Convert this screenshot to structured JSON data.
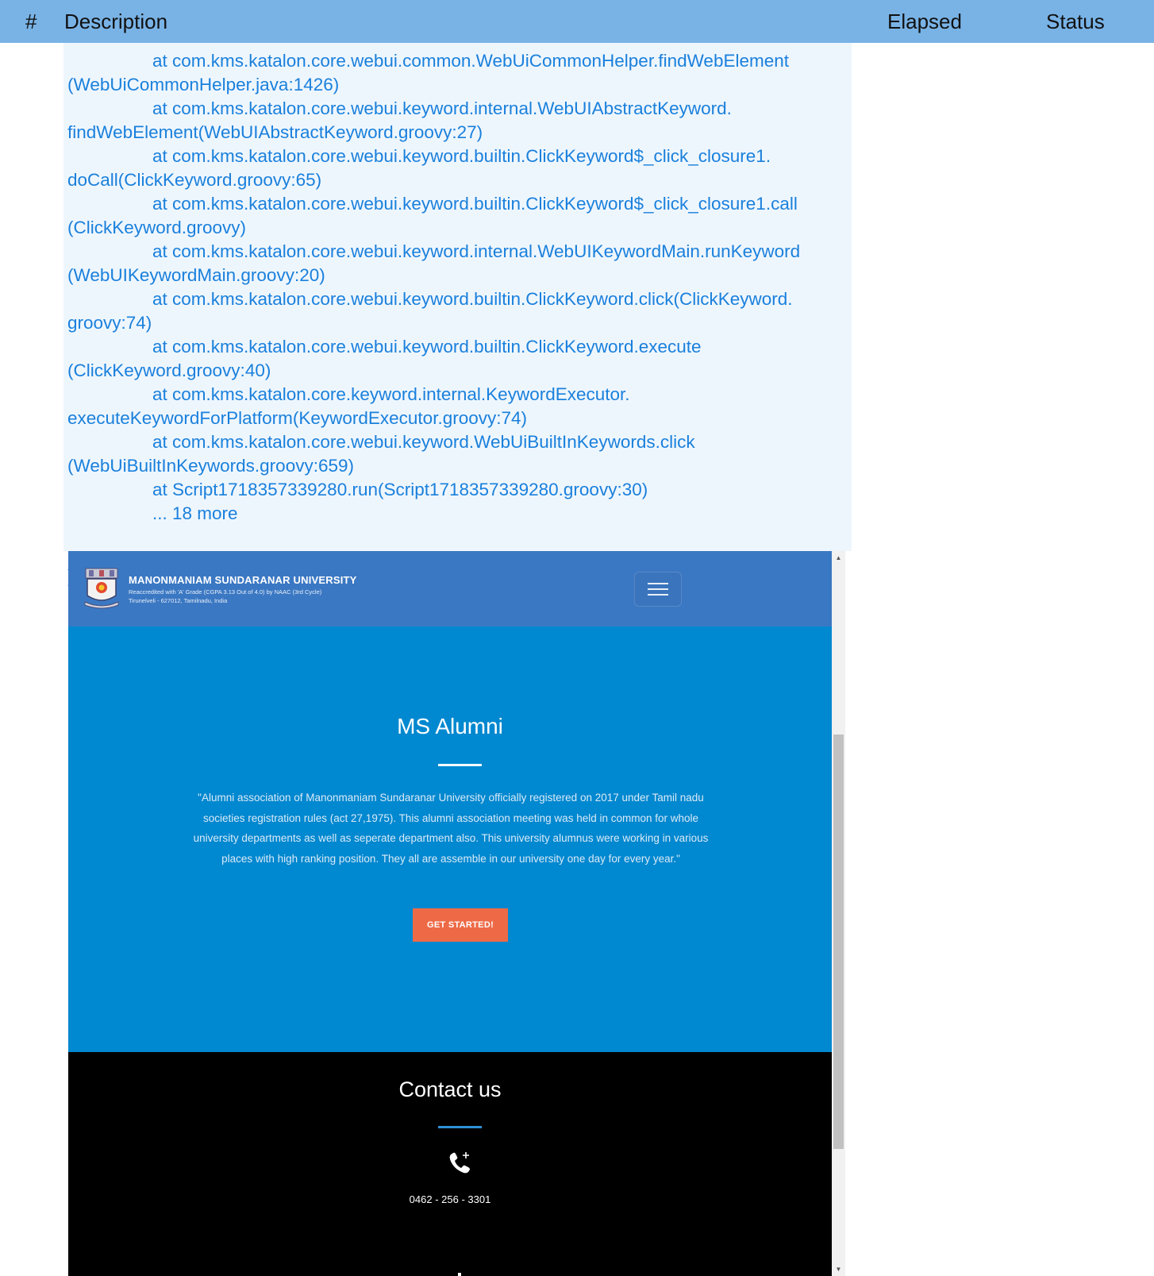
{
  "report_header": {
    "hash": "#",
    "description": "Description",
    "elapsed": "Elapsed",
    "status": "Status"
  },
  "log": {
    "lines": [
      {
        "indent": true,
        "text": "at com.kms.katalon.core.webui.common.WebUiCommonHelper.findWebElement"
      },
      {
        "indent": false,
        "text": "(WebUiCommonHelper.java:1426)"
      },
      {
        "indent": true,
        "text": "at com.kms.katalon.core.webui.keyword.internal.WebUIAbstractKeyword."
      },
      {
        "indent": false,
        "text": "findWebElement(WebUIAbstractKeyword.groovy:27)"
      },
      {
        "indent": true,
        "text": "at com.kms.katalon.core.webui.keyword.builtin.ClickKeyword$_click_closure1."
      },
      {
        "indent": false,
        "text": "doCall(ClickKeyword.groovy:65)"
      },
      {
        "indent": true,
        "text": "at com.kms.katalon.core.webui.keyword.builtin.ClickKeyword$_click_closure1.call"
      },
      {
        "indent": false,
        "text": "(ClickKeyword.groovy)"
      },
      {
        "indent": true,
        "text": "at com.kms.katalon.core.webui.keyword.internal.WebUIKeywordMain.runKeyword"
      },
      {
        "indent": false,
        "text": "(WebUIKeywordMain.groovy:20)"
      },
      {
        "indent": true,
        "text": "at com.kms.katalon.core.webui.keyword.builtin.ClickKeyword.click(ClickKeyword."
      },
      {
        "indent": false,
        "text": "groovy:74)"
      },
      {
        "indent": true,
        "text": "at com.kms.katalon.core.webui.keyword.builtin.ClickKeyword.execute"
      },
      {
        "indent": false,
        "text": "(ClickKeyword.groovy:40)"
      },
      {
        "indent": true,
        "text": "at com.kms.katalon.core.keyword.internal.KeywordExecutor."
      },
      {
        "indent": false,
        "text": "executeKeywordForPlatform(KeywordExecutor.groovy:74)"
      },
      {
        "indent": true,
        "text": "at com.kms.katalon.core.webui.keyword.WebUiBuiltInKeywords.click"
      },
      {
        "indent": false,
        "text": "(WebUiBuiltInKeywords.groovy:659)"
      },
      {
        "indent": true,
        "text": "at Script1718357339280.run(Script1718357339280.groovy:30)"
      },
      {
        "indent": true,
        "text": "... 18 more"
      }
    ],
    "closing": ")"
  },
  "site": {
    "university_name": "MANONMANIAM SUNDARANAR UNIVERSITY",
    "accreditation": "Reaccredited with 'A' Grade (CGPA 3.13 Out of 4.0) by NAAC (3rd Cycle)",
    "location": "Tirunelveli - 627012, Tamilnadu, India",
    "hero": {
      "title": "MS Alumni",
      "text": "\"Alumni association of Manonmaniam Sundaranar University officially registered on 2017 under Tamil nadu societies registration rules (act 27,1975). This alumni association meeting was held in common for whole university departments as well as seperate department also. This university alumnus were working in various places with high ranking position. They all are assemble in our university one day for every year.\"",
      "cta_label": "GET STARTED!"
    },
    "contact": {
      "title": "Contact us",
      "phone": "0462 - 256 - 3301"
    }
  },
  "colors": {
    "report_header": "#79b3e6",
    "log_background": "#eef6fd",
    "log_text": "#1a80dc",
    "navbar": "#3b78c3",
    "hero": "#0088d0",
    "cta": "#ee6a47",
    "contact_background": "#000000"
  },
  "icons": {
    "logo": "university-logo",
    "menu": "hamburger-menu-icon",
    "phone": "phone-plus-icon",
    "direction": "signpost-icon"
  }
}
